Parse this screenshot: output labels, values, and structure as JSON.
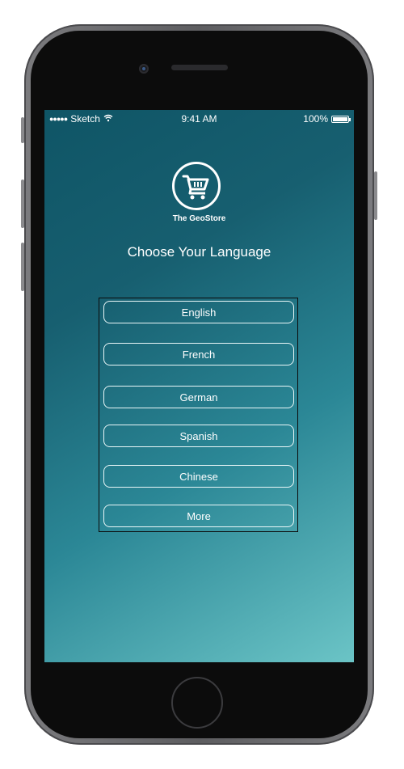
{
  "status_bar": {
    "carrier": "Sketch",
    "signal_dots": "●●●●●",
    "wifi_icon": "wifi-icon",
    "time": "9:41 AM",
    "battery": "100%"
  },
  "brand": {
    "logo_icon": "shopping-cart-icon",
    "name": "The GeoStore"
  },
  "main": {
    "heading": "Choose Your Language",
    "languages": [
      "English",
      "French",
      "German",
      "Spanish",
      "Chinese",
      "More"
    ]
  },
  "colors": {
    "screen_top": "#0f5566",
    "screen_bottom": "#6bc4c6",
    "text": "#ffffff"
  }
}
